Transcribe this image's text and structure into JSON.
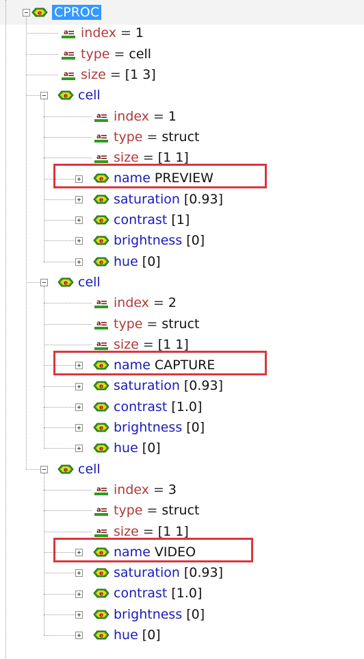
{
  "tree": {
    "root": {
      "name": "CPROC",
      "selected": true
    },
    "root_attrs": [
      {
        "name": "index",
        "value": "1"
      },
      {
        "name": "type",
        "value": "cell"
      },
      {
        "name": "size",
        "value": "[1 3]"
      }
    ],
    "cells": [
      {
        "name": "cell",
        "attrs": [
          {
            "name": "index",
            "value": "1"
          },
          {
            "name": "type",
            "value": "struct"
          },
          {
            "name": "size",
            "value": "[1 1]"
          }
        ],
        "children": [
          {
            "name": "name",
            "text": "PREVIEW",
            "highlighted": true
          },
          {
            "name": "saturation",
            "text": "[0.93]"
          },
          {
            "name": "contrast",
            "text": "[1]"
          },
          {
            "name": "brightness",
            "text": "[0]"
          },
          {
            "name": "hue",
            "text": "[0]"
          }
        ]
      },
      {
        "name": "cell",
        "attrs": [
          {
            "name": "index",
            "value": "2"
          },
          {
            "name": "type",
            "value": "struct"
          },
          {
            "name": "size",
            "value": "[1 1]"
          }
        ],
        "children": [
          {
            "name": "name",
            "text": "CAPTURE",
            "highlighted": true
          },
          {
            "name": "saturation",
            "text": "[0.93]"
          },
          {
            "name": "contrast",
            "text": "[1.0]"
          },
          {
            "name": "brightness",
            "text": "[0]"
          },
          {
            "name": "hue",
            "text": "[0]"
          }
        ]
      },
      {
        "name": "cell",
        "attrs": [
          {
            "name": "index",
            "value": "3"
          },
          {
            "name": "type",
            "value": "struct"
          },
          {
            "name": "size",
            "value": "[1 1]"
          }
        ],
        "children": [
          {
            "name": "name",
            "text": "VIDEO",
            "highlighted": true
          },
          {
            "name": "saturation",
            "text": "[0.93]"
          },
          {
            "name": "contrast",
            "text": "[1.0]"
          },
          {
            "name": "brightness",
            "text": "[0]"
          },
          {
            "name": "hue",
            "text": "[0]"
          }
        ]
      }
    ],
    "attr_operator": "=",
    "icons": {
      "element": "element-node-icon",
      "attribute": "attribute-node-icon"
    }
  },
  "colors": {
    "element_text": "#1a1ab8",
    "attribute_name": "#b03a3a",
    "selection": "#3399ff",
    "highlight_box": "#d9363e",
    "icon_green": "#2e9a1f",
    "icon_yellow": "#f2d21c"
  }
}
